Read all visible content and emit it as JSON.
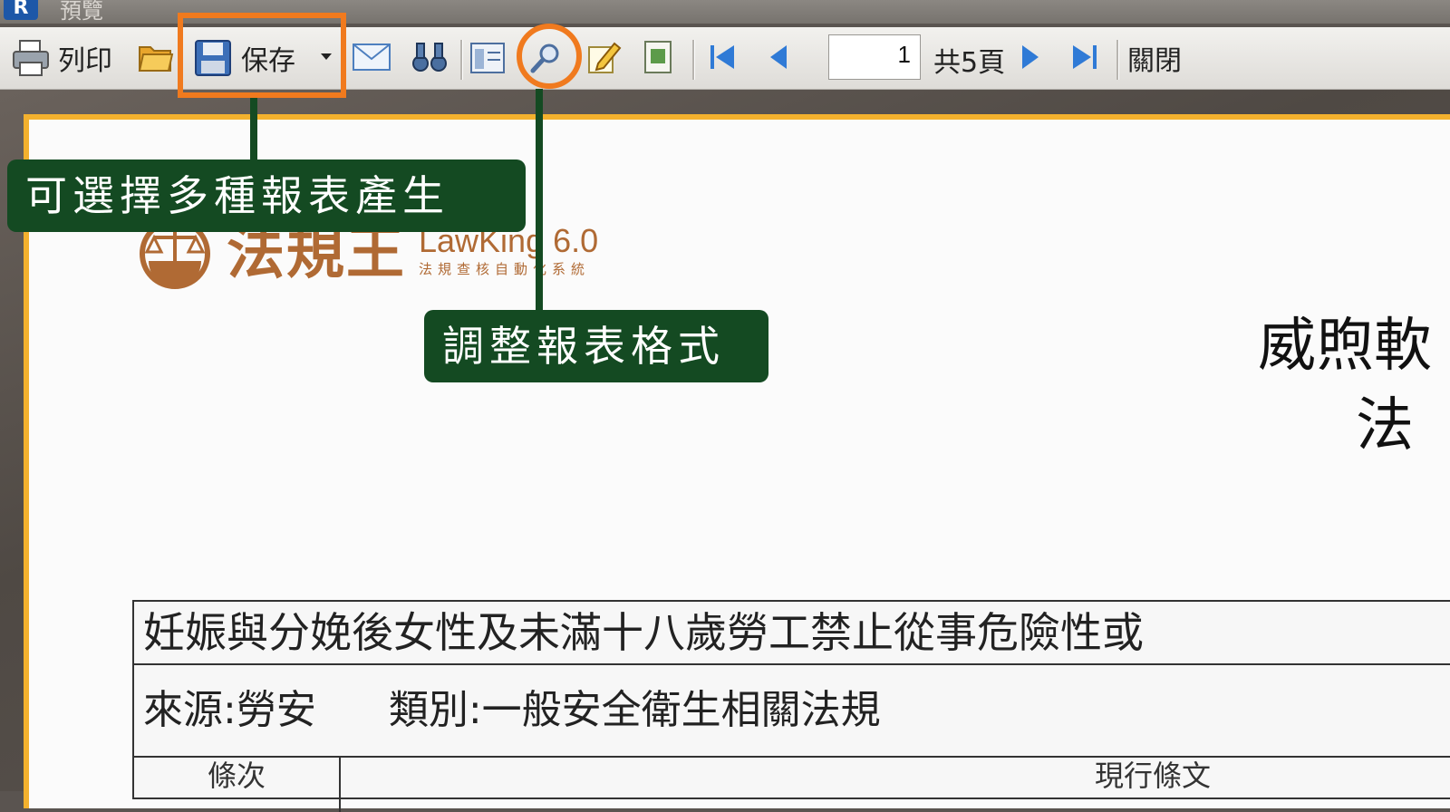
{
  "window": {
    "title": "預覽"
  },
  "toolbar": {
    "print_label": "列印",
    "save_label": "保存",
    "page_current": "1",
    "page_total": "共5頁",
    "close_label": "關閉"
  },
  "annotations": {
    "save_callout": "可選擇多種報表產生",
    "format_callout": "調整報表格式"
  },
  "document": {
    "logo_cn": "法規王",
    "logo_en": "LawKing 6.0",
    "logo_sub": "法規查核自動化系統",
    "title_line1": "威煦軟",
    "title_line2": "法",
    "table": {
      "heading": "妊娠與分娩後女性及未滿十八歲勞工禁止從事危險性或",
      "source": "來源:勞安",
      "category": "類別:一般安全衛生相關法規",
      "col1": "條次",
      "col2": "現行條文"
    }
  },
  "colors": {
    "highlight": "#f07a1e",
    "callout_bg": "#144a22",
    "page_border": "#f3b12e",
    "logo": "#b06a34"
  }
}
